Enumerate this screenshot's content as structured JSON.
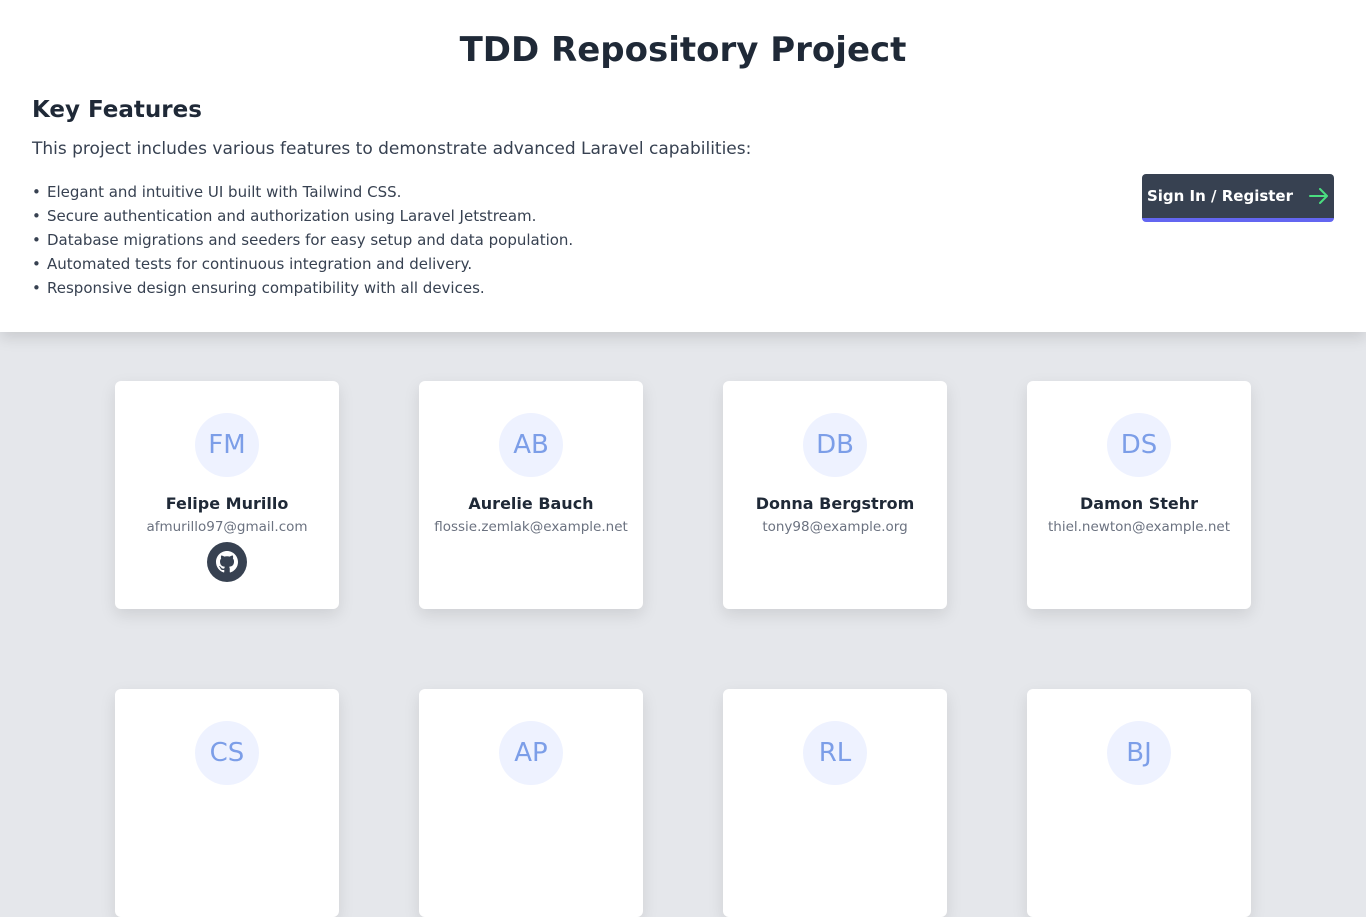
{
  "header": {
    "title": "TDD Repository Project",
    "features_title": "Key Features",
    "features_intro": "This project includes various features to demonstrate advanced Laravel capabilities:",
    "features": [
      "Elegant and intuitive UI built with Tailwind CSS.",
      "Secure authentication and authorization using Laravel Jetstream.",
      "Database migrations and seeders for easy setup and data population.",
      "Automated tests for continuous integration and delivery.",
      "Responsive design ensuring compatibility with all devices."
    ],
    "signin_label": "Sign In / Register",
    "signin_icon": "arrow-right-icon",
    "accent_color": "#6366f1",
    "arrow_color": "#4ade80"
  },
  "users": [
    {
      "initials": "FM",
      "name": "Felipe Murillo",
      "email": "afmurillo97@gmail.com",
      "github_icon": "github-icon"
    },
    {
      "initials": "AB",
      "name": "Aurelie Bauch",
      "email": "flossie.zemlak@example.net"
    },
    {
      "initials": "DB",
      "name": "Donna Bergstrom",
      "email": "tony98@example.org"
    },
    {
      "initials": "DS",
      "name": "Damon Stehr",
      "email": "thiel.newton@example.net"
    },
    {
      "initials": "CS"
    },
    {
      "initials": "AP"
    },
    {
      "initials": "RL"
    },
    {
      "initials": "BJ"
    }
  ]
}
